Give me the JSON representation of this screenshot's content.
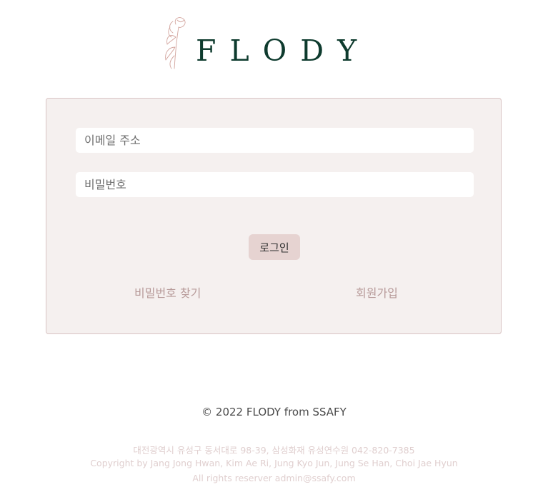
{
  "header": {
    "logo_text": "FLODY",
    "logo_icon": "tulip-icon",
    "brand_color": "#0e3b2e"
  },
  "login": {
    "email_placeholder": "이메일 주소",
    "email_value": "",
    "password_placeholder": "비밀번호",
    "password_value": "",
    "login_label": "로그인",
    "find_password_label": "비밀번호 찾기",
    "signup_label": "회원가입"
  },
  "footer": {
    "copyright": "© 2022 FLODY from SSAFY",
    "address": "대전광역시 유성구 동서대로 98-39, 삼성화재 유성연수원 042-820-7385",
    "credits": "Copyright by Jang Jong Hwan, Kim Ae Ri, Jung Kyo Jun, Jung Se Han, Choi Jae Hyun",
    "rights": "All rights reserver admin@ssafy.com"
  },
  "colors": {
    "card_background": "#f5f0ef",
    "card_border": "#d9c4c4",
    "button_background": "#e6d3d1",
    "link_color": "#b79a99",
    "footer_muted": "#e0cfcf"
  }
}
